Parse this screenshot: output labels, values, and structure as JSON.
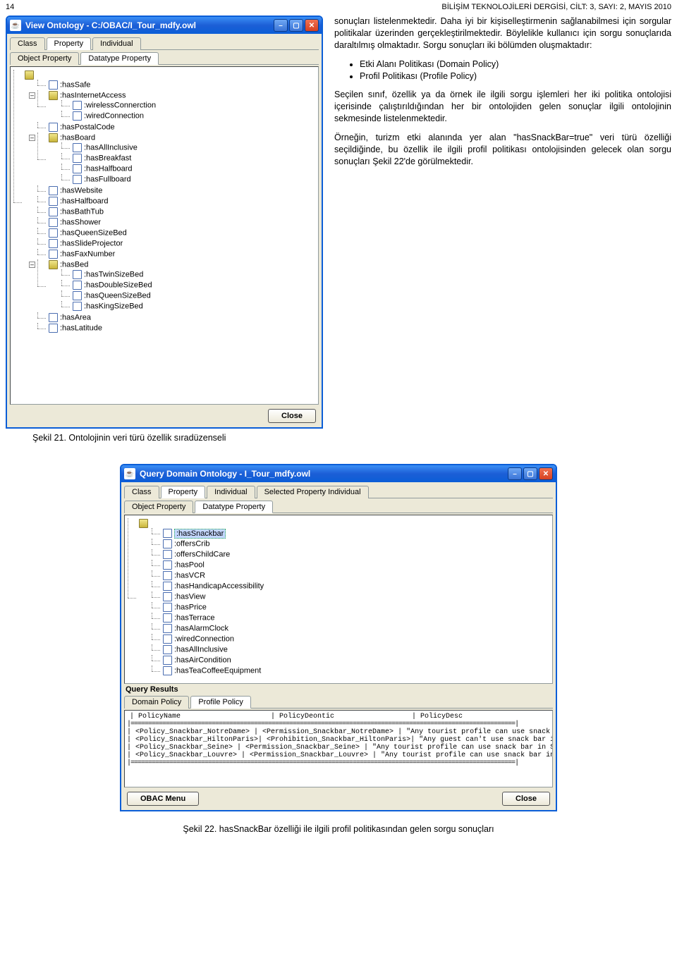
{
  "page": {
    "number": "14",
    "journal": "BİLİŞİM TEKNOLOJİLERİ DERGİSİ, CİLT: 3, SAYI: 2, MAYIS 2010"
  },
  "window1": {
    "title": "View Ontology - C:/OBAC/I_Tour_mdfy.owl",
    "tabs1": [
      "Class",
      "Property",
      "Individual"
    ],
    "tabs2": [
      "Object Property",
      "Datatype Property"
    ],
    "close_label": "Close",
    "tree": [
      {
        "t": "root",
        "children": [
          {
            "t": "doc",
            "label": ":hasSafe"
          },
          {
            "t": "folder",
            "open": true,
            "label": ":hasInternetAccess",
            "children": [
              {
                "t": "doc",
                "label": ":wirelessConnerction"
              },
              {
                "t": "doc",
                "label": ":wiredConnection"
              }
            ]
          },
          {
            "t": "doc",
            "label": ":hasPostalCode"
          },
          {
            "t": "folder",
            "open": true,
            "label": ":hasBoard",
            "children": [
              {
                "t": "doc",
                "label": ":hasAllInclusive"
              },
              {
                "t": "doc",
                "label": ":hasBreakfast"
              },
              {
                "t": "doc",
                "label": ":hasHalfboard"
              },
              {
                "t": "doc",
                "label": ":hasFullboard"
              }
            ]
          },
          {
            "t": "doc",
            "label": ":hasWebsite"
          },
          {
            "t": "doc",
            "label": ":hasHalfboard"
          },
          {
            "t": "doc",
            "label": ":hasBathTub"
          },
          {
            "t": "doc",
            "label": ":hasShower"
          },
          {
            "t": "doc",
            "label": ":hasQueenSizeBed"
          },
          {
            "t": "doc",
            "label": ":hasSlideProjector"
          },
          {
            "t": "doc",
            "label": ":hasFaxNumber"
          },
          {
            "t": "folder",
            "open": true,
            "label": ":hasBed",
            "children": [
              {
                "t": "doc",
                "label": ":hasTwinSizeBed"
              },
              {
                "t": "doc",
                "label": ":hasDoubleSizeBed"
              },
              {
                "t": "doc",
                "label": ":hasQueenSizeBed"
              },
              {
                "t": "doc",
                "label": ":hasKingSizeBed"
              }
            ]
          },
          {
            "t": "doc",
            "label": ":hasArea"
          },
          {
            "t": "doc",
            "label": ":hasLatitude"
          }
        ]
      }
    ]
  },
  "article": {
    "p1": "sonuçları listelenmektedir. Daha iyi bir kişiselleştirmenin sağlanabilmesi için sorgular politikalar üzerinden gerçekleştirilmektedir. Böylelikle kullanıcı için sorgu sonuçlarıda daraltılmış olmaktadır. Sorgu sonuçları iki bölümden oluşmaktadır:",
    "li1": "Etki Alanı Politikası (Domain Policy)",
    "li2": "Profil Politikası (Profile Policy)",
    "p2": "Seçilen sınıf, özellik ya da örnek ile ilgili sorgu işlemleri her iki politika ontolojisi içerisinde çalıştırıldığından her bir ontolojiden gelen sonuçlar ilgili ontolojinin sekmesinde listelenmektedir.",
    "p3": "Örneğin, turizm etki alanında yer alan \"hasSnackBar=true\" veri türü özelliği seçildiğinde, bu özellik ile ilgili profil politikası ontolojisinden gelecek olan sorgu sonuçları Şekil 22'de görülmektedir."
  },
  "caption1": "Şekil 21. Ontolojinin veri türü özellik sıradüzenseli",
  "window2": {
    "title": "Query Domain Ontology - I_Tour_mdfy.owl",
    "tabs1": [
      "Class",
      "Property",
      "Individual",
      "Selected Property Individual"
    ],
    "tabs2": [
      "Object Property",
      "Datatype Property"
    ],
    "results_label": "Query Results",
    "result_tabs": [
      "Domain Policy",
      "Profile Policy"
    ],
    "obac_label": "OBAC Menu",
    "close_label": "Close",
    "tree": [
      {
        "t": "root",
        "children": [
          {
            "t": "doc",
            "label": ":hasSnackbar",
            "sel": true
          },
          {
            "t": "doc",
            "label": ":offersCrib"
          },
          {
            "t": "doc",
            "label": ":offersChildCare"
          },
          {
            "t": "doc",
            "label": ":hasPool"
          },
          {
            "t": "doc",
            "label": ":hasVCR"
          },
          {
            "t": "doc",
            "label": ":hasHandicapAccessibility"
          },
          {
            "t": "doc",
            "label": ":hasView"
          },
          {
            "t": "doc",
            "label": ":hasPrice"
          },
          {
            "t": "doc",
            "label": ":hasTerrace"
          },
          {
            "t": "doc",
            "label": ":hasAlarmClock"
          },
          {
            "t": "doc",
            "label": ":wiredConnection"
          },
          {
            "t": "doc",
            "label": ":hasAllInclusive"
          },
          {
            "t": "doc",
            "label": ":hasAirCondition"
          },
          {
            "t": "doc",
            "label": ":hasTeaCoffeeEquipment"
          }
        ]
      }
    ],
    "cols": [
      "| PolicyName",
      "| PolicyDeontic",
      "| PolicyDesc"
    ],
    "sep": "|=============================================================================================================|",
    "rows": [
      "| <Policy_Snackbar_NotreDame>  | <Permission_Snackbar_NotreDame>   | \"Any tourist profile can use snack bar in NotreDame.\"",
      "| <Policy_Snackbar_HiltonParis>| <Prohibition_Snackbar_HiltonParis>| \"Any guest can't use snack bar in HiltonParis.\"^^<http://ww",
      "| <Policy_Snackbar_Seine>      | <Permission_Snackbar_Seine>       | \"Any tourist profile can use snack bar in Seine.\"^^<http://www",
      "| <Policy_Snackbar_Louvre>     | <Permission_Snackbar_Louvre>      | \"Any tourist profile can use snack bar in Louvre.\"^^<http://w"
    ]
  },
  "caption2": "Şekil 22. hasSnackBar özelliği ile ilgili profil politikasından gelen sorgu sonuçları"
}
